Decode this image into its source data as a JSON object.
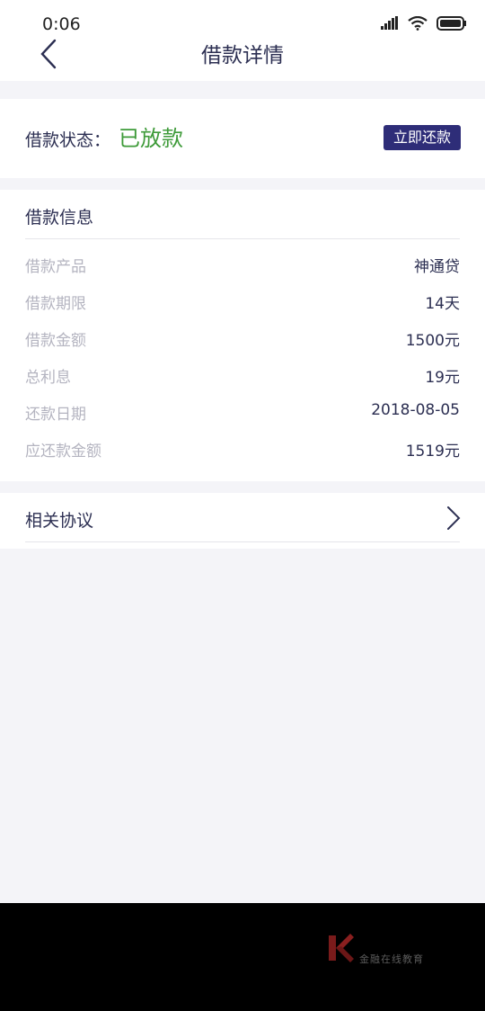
{
  "status_bar": {
    "time": "0:06"
  },
  "header": {
    "title": "借款详情"
  },
  "loan_status": {
    "label": "借款状态：",
    "value": "已放款",
    "repay_button_label": "立即还款",
    "value_color": "#3f9b3a",
    "button_color": "#2e2d78"
  },
  "loan_info": {
    "title": "借款信息",
    "rows": [
      {
        "label": "借款产品",
        "value": "神通贷"
      },
      {
        "label": "借款期限",
        "value": "14天"
      },
      {
        "label": "借款金额",
        "value": "1500元"
      },
      {
        "label": "总利息",
        "value": "19元"
      },
      {
        "label": "还款日期",
        "value": "2018-08-05"
      },
      {
        "label": "应还款金额",
        "value": "1519元"
      }
    ]
  },
  "agreement": {
    "label": "相关协议"
  },
  "watermark": {
    "text": "金融在线教育"
  }
}
